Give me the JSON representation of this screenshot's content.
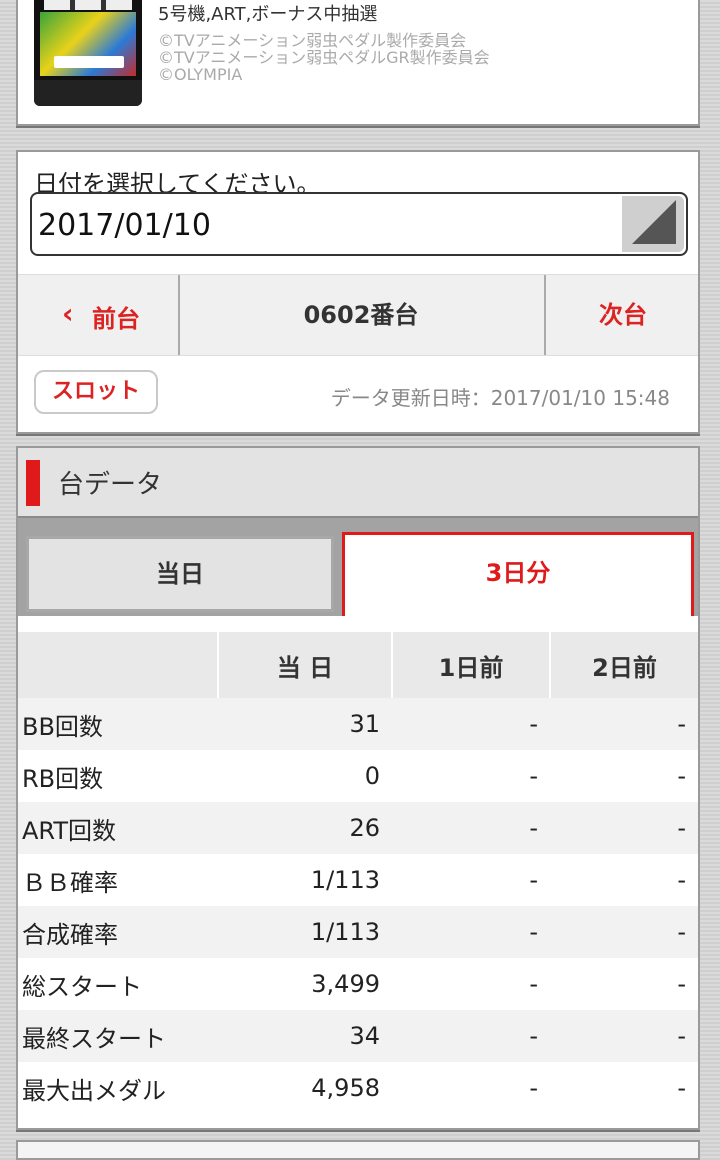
{
  "machine": {
    "description": "5号機,ART,ボーナス中抽選",
    "copyright_lines": [
      "©TVアニメーション弱虫ペダル製作委員会",
      "©TVアニメーション弱虫ペダルGR製作委員会",
      "©OLYMPIA"
    ]
  },
  "date_select": {
    "prompt": "日付を選択してください。",
    "value": "2017/01/10"
  },
  "nav": {
    "prev_label": "前台",
    "unit_label": "0602番台",
    "next_label": "次台"
  },
  "category_button": "スロット",
  "updated_text": "データ更新日時：2017/01/10 15:48",
  "section_title": "台データ",
  "tabs": {
    "today": "当日",
    "three_days": "3日分",
    "active": "three_days"
  },
  "table": {
    "headers": [
      "",
      "当 日",
      "1日前",
      "2日前"
    ],
    "rows": [
      {
        "label": "BB回数",
        "values": [
          "31",
          "-",
          "-"
        ]
      },
      {
        "label": "RB回数",
        "values": [
          "0",
          "-",
          "-"
        ]
      },
      {
        "label": "ART回数",
        "values": [
          "26",
          "-",
          "-"
        ]
      },
      {
        "label": "ＢＢ確率",
        "values": [
          "1/113",
          "-",
          "-"
        ]
      },
      {
        "label": "合成確率",
        "values": [
          "1/113",
          "-",
          "-"
        ]
      },
      {
        "label": "総スタート",
        "values": [
          "3,499",
          "-",
          "-"
        ]
      },
      {
        "label": "最終スタート",
        "values": [
          "34",
          "-",
          "-"
        ]
      },
      {
        "label": "最大出メダル",
        "values": [
          "4,958",
          "-",
          "-"
        ]
      }
    ]
  },
  "colors": {
    "accent": "#e0191a",
    "header_bg": "#e3e3e3"
  }
}
